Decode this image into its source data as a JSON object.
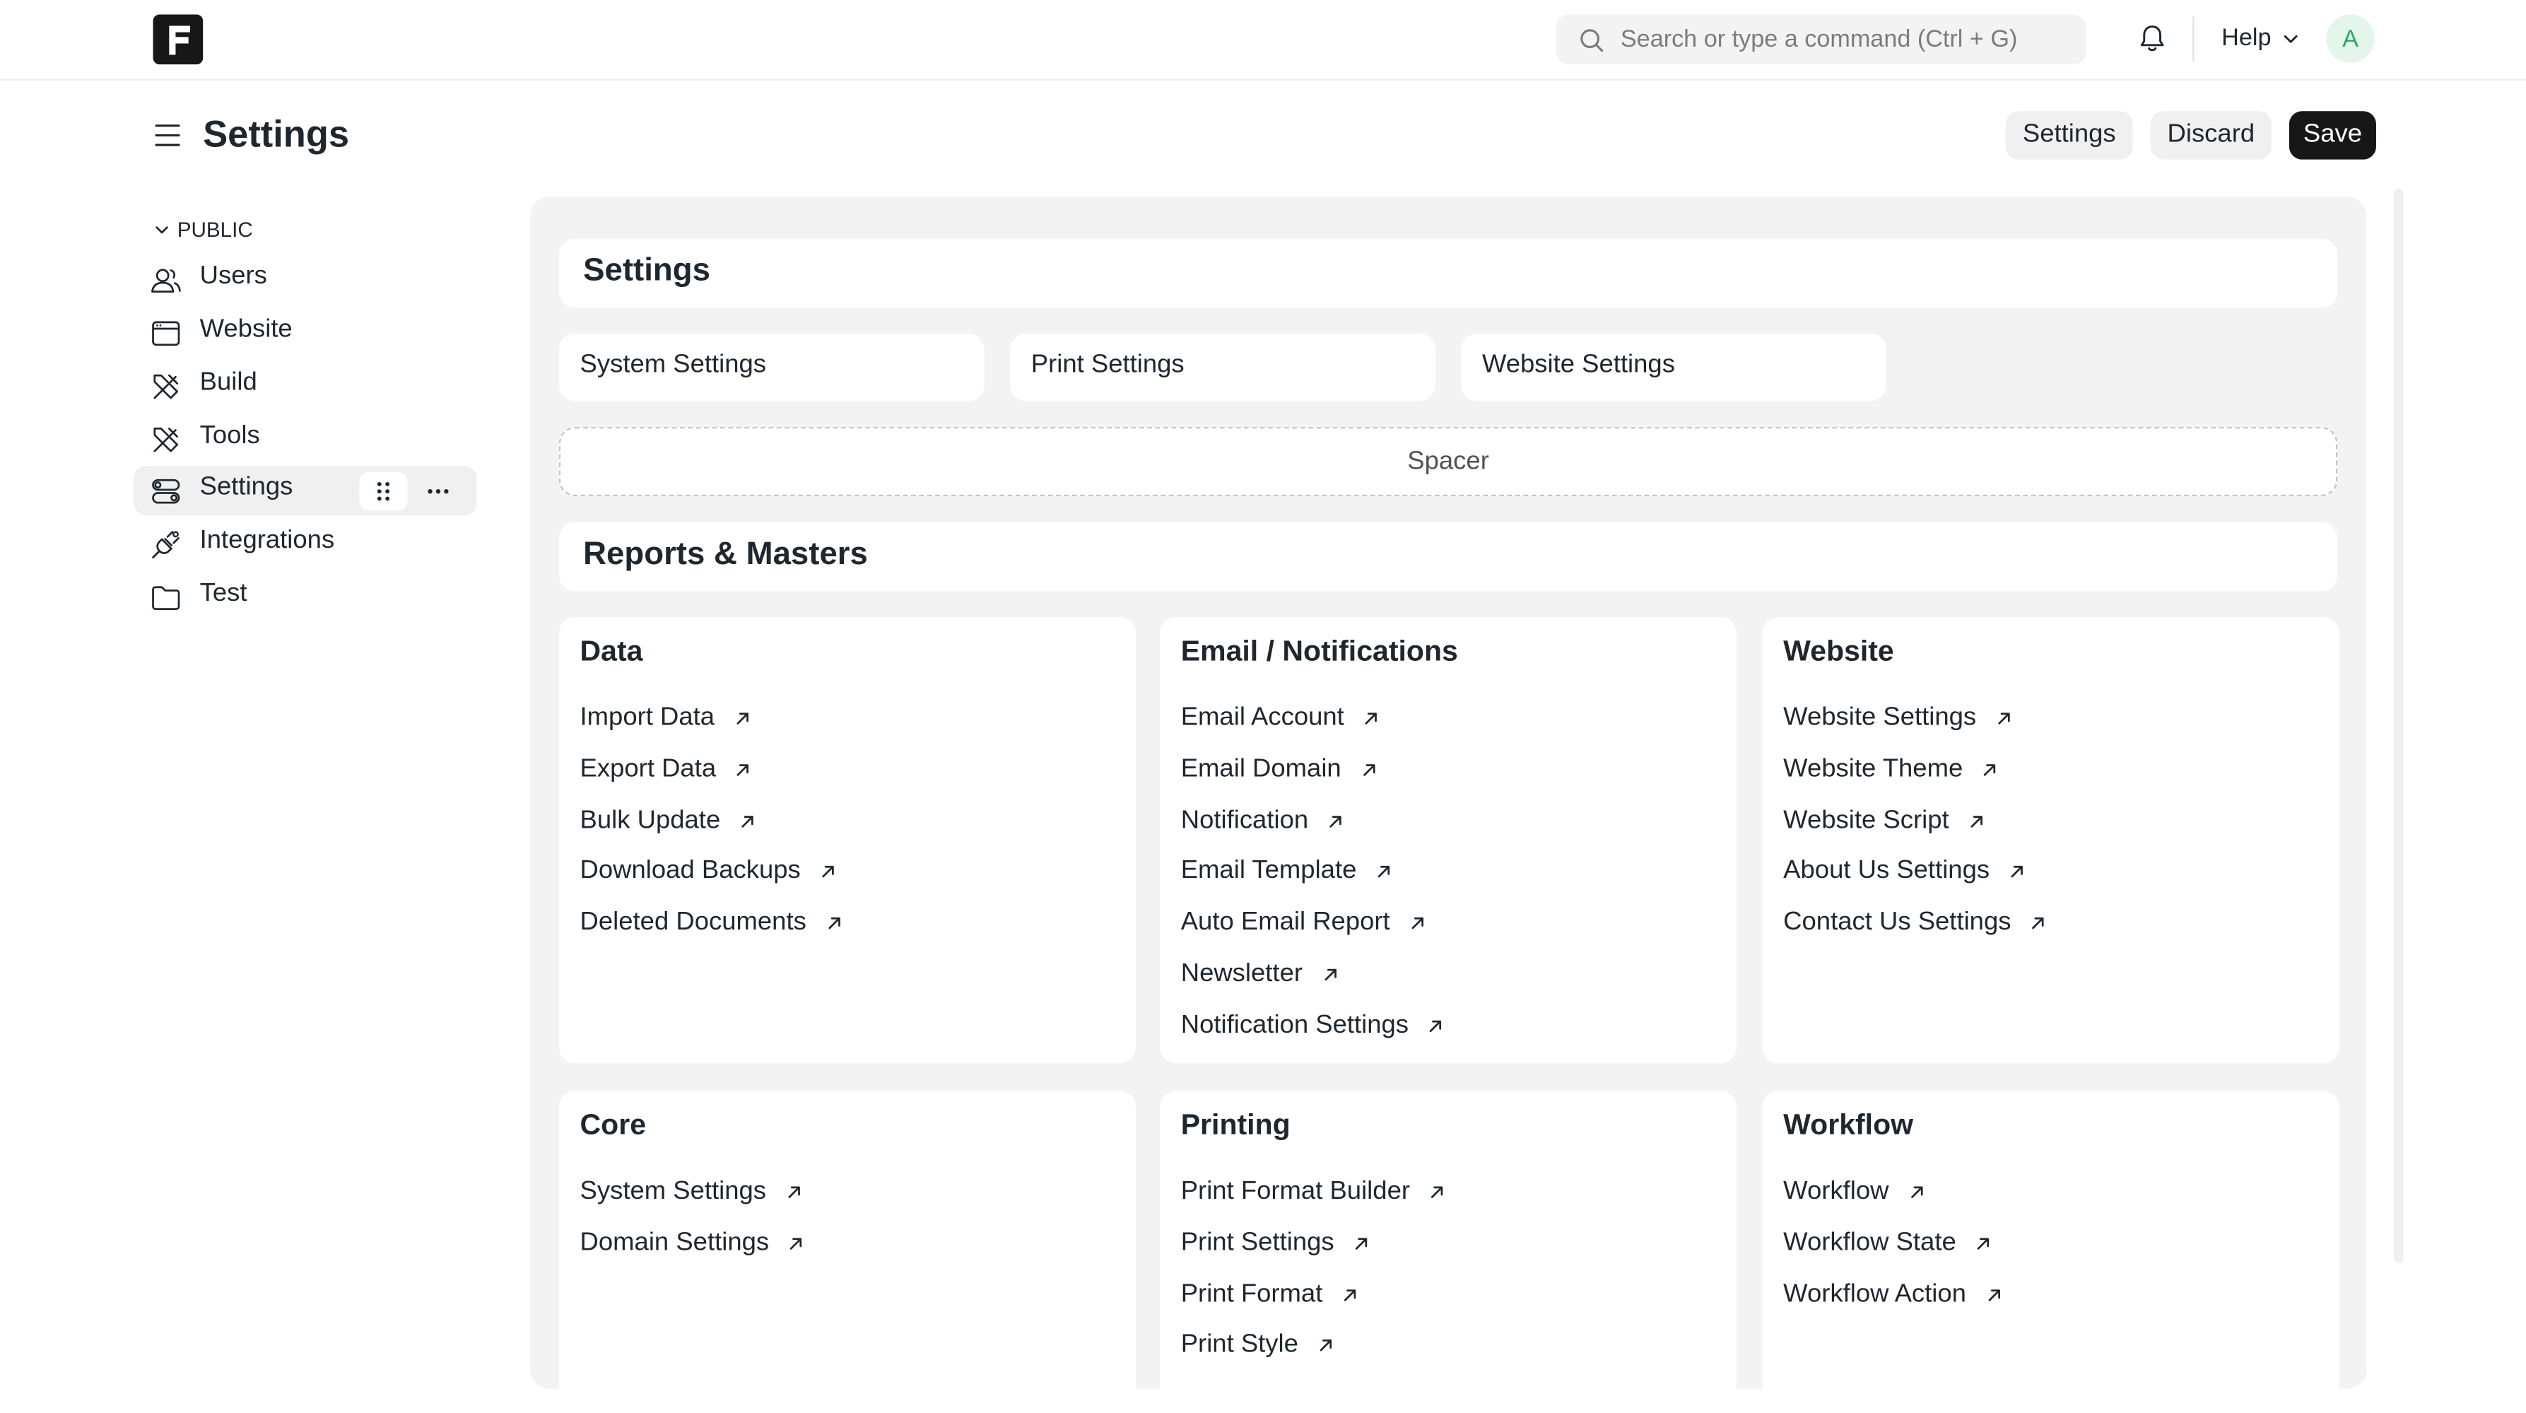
{
  "navbar": {
    "logo_letter": "F",
    "search_placeholder": "Search or type a command (Ctrl + G)",
    "help_label": "Help",
    "avatar_letter": "A"
  },
  "page": {
    "title": "Settings",
    "buttons": {
      "settings": "Settings",
      "discard": "Discard",
      "save": "Save"
    }
  },
  "sidebar": {
    "section_label": "PUBLIC",
    "items": [
      {
        "label": "Users",
        "icon": "users-icon"
      },
      {
        "label": "Website",
        "icon": "browser-window-icon"
      },
      {
        "label": "Build",
        "icon": "tools-icon"
      },
      {
        "label": "Tools",
        "icon": "tools-icon"
      },
      {
        "label": "Settings",
        "icon": "toggles-icon",
        "active": true
      },
      {
        "label": "Integrations",
        "icon": "plug-icon"
      },
      {
        "label": "Test",
        "icon": "folder-icon"
      }
    ]
  },
  "workspace": {
    "settings_header": "Settings",
    "shortcuts": [
      "System Settings",
      "Print Settings",
      "Website Settings"
    ],
    "spacer_label": "Spacer",
    "reports_header": "Reports & Masters",
    "cards": [
      {
        "title": "Data",
        "links": [
          "Import Data",
          "Export Data",
          "Bulk Update",
          "Download Backups",
          "Deleted Documents"
        ]
      },
      {
        "title": "Email / Notifications",
        "links": [
          "Email Account",
          "Email Domain",
          "Notification",
          "Email Template",
          "Auto Email Report",
          "Newsletter",
          "Notification Settings"
        ]
      },
      {
        "title": "Website",
        "links": [
          "Website Settings",
          "Website Theme",
          "Website Script",
          "About Us Settings",
          "Contact Us Settings"
        ]
      },
      {
        "title": "Core",
        "links": [
          "System Settings",
          "Domain Settings"
        ]
      },
      {
        "title": "Printing",
        "links": [
          "Print Format Builder",
          "Print Settings",
          "Print Format",
          "Print Style"
        ]
      },
      {
        "title": "Workflow",
        "links": [
          "Workflow",
          "Workflow State",
          "Workflow Action"
        ]
      }
    ]
  },
  "colors": {
    "primary": "#171717",
    "surface": "#f3f3f3",
    "text": "#1f272e",
    "avatar_bg": "#e4f5e9",
    "avatar_fg": "#30a66d"
  }
}
